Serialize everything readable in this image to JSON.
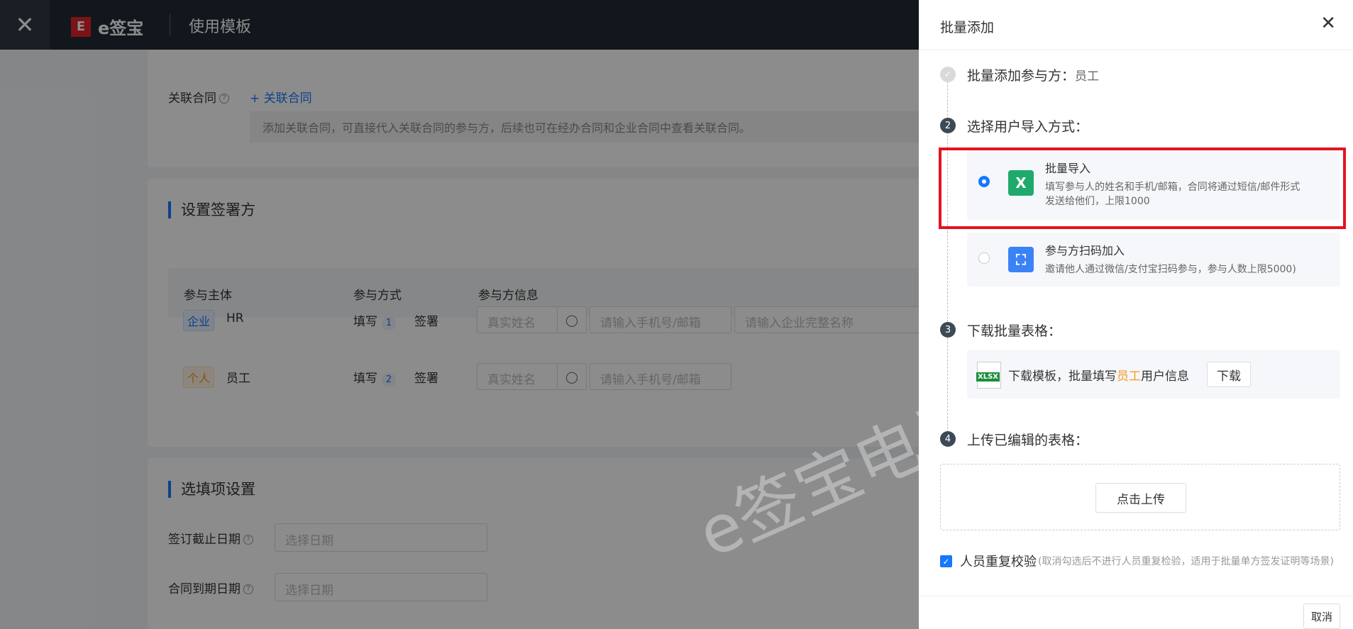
{
  "topbar": {
    "close": "✕",
    "logo_mark": "E",
    "logo_text": "e签宝",
    "title": "使用模板"
  },
  "left": {
    "related_label": "关联合同",
    "related_link": "+ 关联合同",
    "related_note": "添加关联合同，可直接代入关联合同的参与方，后续也可在经办合同和企业合同中查看关联合同。",
    "section_signers": "设置签署方",
    "table_headers": [
      "参与主体",
      "参与方式",
      "参与方信息"
    ],
    "rows": [
      {
        "tag": "企业",
        "name": "HR",
        "fill": "填写",
        "fill_no": "1",
        "sign": "签署",
        "name_ph": "真实姓名",
        "contact_ph": "请输入手机号/邮箱",
        "company_ph": "请输入企业完整名称"
      },
      {
        "tag": "个人",
        "name": "员工",
        "fill": "填写",
        "fill_no": "2",
        "sign": "签署",
        "name_ph": "真实姓名",
        "contact_ph": "请输入手机号/邮箱"
      }
    ],
    "section_optional": "选填项设置",
    "deadline_label": "签订截止日期",
    "expire_label": "合同到期日期",
    "date_ph": "选择日期"
  },
  "watermark": "e签宝电子签名",
  "drawer": {
    "title": "批量添加",
    "close": "✕",
    "step1_label": "批量添加参与方：",
    "step1_value": "员工",
    "step2_no": "2",
    "step2_label": "选择用户导入方式：",
    "opt1_title": "批量导入",
    "opt1_desc_l1": "填写参与人的姓名和手机/邮箱，合同将通过短信/邮件形式",
    "opt1_desc_l2": "发送给他们，上限1000",
    "opt2_title": "参与方扫码加入",
    "opt2_desc": "邀请他人通过微信/支付宝扫码参与，参与人数上限5000)",
    "step3_no": "3",
    "step3_label": "下载批量表格：",
    "xlsx_badge": "XLSX",
    "dl_text_pre": "下载模板，批量填写",
    "dl_text_highlight": "员工",
    "dl_text_post": "用户信息",
    "dl_button": "下载",
    "step4_no": "4",
    "step4_label": "上传已编辑的表格：",
    "upload_button": "点击上传",
    "check_label": "人员重复校验",
    "check_note": "(取消勾选后不进行人员重复检验，适用于批量单方签发证明等场景)",
    "cancel_button": "取消"
  },
  "colors": {
    "accent": "#1677ff",
    "highlight_border": "#e3141f",
    "orange": "#f59a23"
  }
}
